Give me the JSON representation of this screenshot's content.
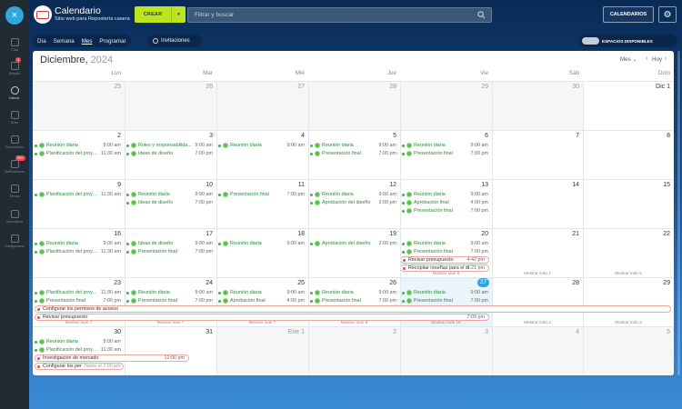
{
  "nav": {
    "items": [
      {
        "label": "Chat",
        "badge": ""
      },
      {
        "label": "Entrada",
        "badge": "1"
      },
      {
        "label": "Calend.",
        "badge": ""
      },
      {
        "label": "Drive",
        "badge": ""
      },
      {
        "label": "Documentos",
        "badge": ""
      },
      {
        "label": "Notificaciones",
        "badge": "99+"
      },
      {
        "label": "Tareas",
        "badge": ""
      },
      {
        "label": "Mensajería",
        "badge": ""
      },
      {
        "label": "Configuración",
        "badge": ""
      }
    ]
  },
  "header": {
    "close_icon": "×",
    "title": "Calendario",
    "subtitle": "Sitio web para Repostería casera",
    "create_label": "CREAR",
    "create_arrow": "▾",
    "search_placeholder": "Filtrar y buscar",
    "calendars_label": "CALENDARIOS",
    "gear_icon": "⚙"
  },
  "viewbar": {
    "tabs": [
      "Día",
      "Semana",
      "Mes",
      "Programar"
    ],
    "active_tab": "Mes",
    "invitations_label": "Invitaciones",
    "spaces_label": "ESPACIOS DISPONIBLES"
  },
  "calendar": {
    "month": "Diciembre,",
    "year": "2024",
    "view_select": "Mes",
    "view_select_arrow": "⌄",
    "prev": "‹",
    "today_label": "Hoy",
    "next": "›",
    "weekdays": [
      "Lun",
      "Mar",
      "Mié",
      "Jue",
      "Vie",
      "Sáb",
      "Dom"
    ],
    "weeks": [
      {
        "days": [
          {
            "label": "25",
            "dim": true,
            "events": []
          },
          {
            "label": "26",
            "dim": true,
            "events": []
          },
          {
            "label": "27",
            "dim": true,
            "events": []
          },
          {
            "label": "28",
            "dim": true,
            "events": []
          },
          {
            "label": "29",
            "dim": true,
            "events": []
          },
          {
            "label": "30",
            "dim": true,
            "events": []
          },
          {
            "label": "Dic 1",
            "dim": false,
            "events": []
          }
        ],
        "bands": []
      },
      {
        "days": [
          {
            "label": "2",
            "events": [
              {
                "t": "Reunión diaria",
                "tm": "9:00 am"
              },
              {
                "t": "Planificación del proye...",
                "tm": "11:30 am"
              }
            ]
          },
          {
            "label": "3",
            "events": [
              {
                "t": "Roles y responsabilida...",
                "tm": "9:00 am"
              },
              {
                "t": "Ideas de diseño",
                "tm": "7:00 pm"
              }
            ]
          },
          {
            "label": "4",
            "events": [
              {
                "t": "Reunión diaria",
                "tm": "9:00 am"
              }
            ]
          },
          {
            "label": "5",
            "events": [
              {
                "t": "Reunión diaria",
                "tm": "9:00 am"
              },
              {
                "t": "Presentación final",
                "tm": "7:00 pm"
              }
            ]
          },
          {
            "label": "6",
            "events": [
              {
                "t": "Reunión diaria",
                "tm": "9:00 am"
              },
              {
                "t": "Presentación final",
                "tm": "7:00 pm"
              }
            ]
          },
          {
            "label": "7",
            "events": []
          },
          {
            "label": "8",
            "events": []
          }
        ],
        "bands": []
      },
      {
        "days": [
          {
            "label": "9",
            "events": [
              {
                "t": "Planificación del proye...",
                "tm": "11:30 am"
              }
            ]
          },
          {
            "label": "10",
            "events": [
              {
                "t": "Reunión diaria",
                "tm": "9:00 am"
              },
              {
                "t": "Ideas de diseño",
                "tm": "7:00 pm"
              }
            ]
          },
          {
            "label": "11",
            "events": [
              {
                "t": "Presentación final",
                "tm": "7:00 pm"
              }
            ]
          },
          {
            "label": "12",
            "events": [
              {
                "t": "Reunión diaria",
                "tm": "9:00 am"
              },
              {
                "t": "Aprobación del diseño",
                "tm": "2:00 pm"
              }
            ]
          },
          {
            "label": "13",
            "events": [
              {
                "t": "Reunión diaria",
                "tm": "9:00 am"
              },
              {
                "t": "Aprobación final",
                "tm": "4:00 pm"
              },
              {
                "t": "Presentación final",
                "tm": "7:00 pm"
              }
            ]
          },
          {
            "label": "14",
            "events": []
          },
          {
            "label": "15",
            "events": []
          }
        ],
        "bands": []
      },
      {
        "days": [
          {
            "label": "16",
            "events": [
              {
                "t": "Reunión diaria",
                "tm": "9:00 am"
              },
              {
                "t": "Planificación del proye...",
                "tm": "11:30 am"
              }
            ]
          },
          {
            "label": "17",
            "events": [
              {
                "t": "Ideas de diseño",
                "tm": "9:00 am"
              },
              {
                "t": "Presentación final",
                "tm": "7:00 pm"
              }
            ]
          },
          {
            "label": "18",
            "events": [
              {
                "t": "Reunión diaria",
                "tm": "9:00 am"
              }
            ]
          },
          {
            "label": "19",
            "events": [
              {
                "t": "Aprobación del diseño",
                "tm": "2:00 pm"
              }
            ]
          },
          {
            "label": "20",
            "events": [
              {
                "t": "Reunión diaria",
                "tm": "9:00 am"
              },
              {
                "t": "Presentación final",
                "tm": "7:00 pm"
              }
            ],
            "extra": [
              {
                "t": "Revisar presupuesto",
                "tm": "4:42 pm"
              },
              {
                "t": "Recopilar reseñas para el si",
                "tm": "5:21 pm"
              }
            ],
            "showall": "Mostrar todo 8"
          },
          {
            "label": "21",
            "events": [],
            "showall": "Mostrar todo 1"
          },
          {
            "label": "22",
            "events": [],
            "showall": "Mostrar todo 5"
          }
        ],
        "bands": []
      },
      {
        "days": [
          {
            "label": "23",
            "events": [
              {
                "t": "Planificación del proye...",
                "tm": "11:30 am"
              },
              {
                "t": "Presentación final",
                "tm": "7:00 pm"
              }
            ],
            "showall": "Mostrar todo 7"
          },
          {
            "label": "24",
            "events": [
              {
                "t": "Reunión diaria",
                "tm": "9:00 am"
              },
              {
                "t": "Presentación final",
                "tm": "7:00 pm"
              }
            ],
            "showall": "Mostrar todo 7"
          },
          {
            "label": "25",
            "events": [
              {
                "t": "Reunión diaria",
                "tm": "9:00 am"
              },
              {
                "t": "Aprobación final",
                "tm": "4:00 pm"
              }
            ],
            "showall": "Mostrar todo 7"
          },
          {
            "label": "26",
            "events": [
              {
                "t": "Reunión diaria",
                "tm": "9:00 am"
              },
              {
                "t": "Presentación final",
                "tm": "7:00 pm"
              }
            ],
            "showall": "Mostrar todo 8"
          },
          {
            "label": "27",
            "today": true,
            "events": [
              {
                "t": "Reunión diaria",
                "tm": "9:00 am"
              },
              {
                "t": "Presentación final",
                "tm": "7:00 pm"
              }
            ],
            "showall": "Mostrar todo 10"
          },
          {
            "label": "28",
            "events": [],
            "showall": "Mostrar todo 2"
          },
          {
            "label": "29",
            "events": [],
            "showall": "Mostrar todo 3"
          }
        ],
        "bands": [
          {
            "t": "Configurar los permisos de acceso",
            "t2": "",
            "tm": ""
          },
          {
            "t": "Revisar presupuesto",
            "t2": "",
            "tm": "7:09 pm"
          }
        ]
      },
      {
        "days": [
          {
            "label": "30",
            "events": [
              {
                "t": "Reunión diaria",
                "tm": "9:00 am"
              },
              {
                "t": "Planificación del proye...",
                "tm": "11:30 am"
              }
            ],
            "tasks": [
              {
                "t": "Investigación de mercado",
                "tm": "12:00 pm"
              },
              {
                "t": "Configurar los per",
                "t2": "hasta el 7:00 pm"
              }
            ]
          },
          {
            "label": "31",
            "events": []
          },
          {
            "label": "Ene 1",
            "dim": true,
            "events": []
          },
          {
            "label": "2",
            "dim": true,
            "events": []
          },
          {
            "label": "3",
            "dim": true,
            "events": []
          },
          {
            "label": "4",
            "dim": true,
            "events": []
          },
          {
            "label": "5",
            "dim": true,
            "events": []
          }
        ],
        "bands": []
      }
    ]
  }
}
